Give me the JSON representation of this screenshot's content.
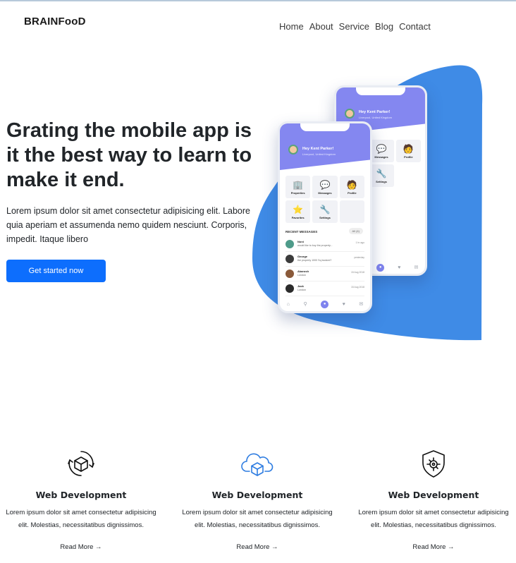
{
  "brand": "BRAINFooD",
  "nav": [
    "Home",
    "About",
    "Service",
    "Blog",
    "Contact"
  ],
  "hero": {
    "title": "Grating the mobile app is it the best way to learn to make it end.",
    "text": "Lorem ipsum dolor sit amet consectetur adipisicing elit. Labore quia aperiam et assumenda nemo quidem nesciunt. Corporis, impedit. Itaque libero",
    "cta": "Get started now"
  },
  "phone": {
    "greeting": "Hey Kent Parker!",
    "location": "Liverpool, United Kingdom",
    "tiles": [
      {
        "label": "Properties",
        "icon": "building-icon"
      },
      {
        "label": "Messages",
        "icon": "chat-icon"
      },
      {
        "label": "Profile",
        "icon": "person-icon"
      },
      {
        "label": "Favorites",
        "icon": "star-icon"
      },
      {
        "label": "Settings",
        "icon": "tools-icon"
      }
    ],
    "messages_title": "RECENT MESSAGES",
    "messages_badge": "All (4)",
    "messages": [
      {
        "name": "Noni",
        "text": "would like to buy the property...",
        "time": "1 hr ago"
      },
      {
        "name": "George",
        "text": "the property 1000 Sq booked?",
        "time": "yesterday"
      },
      {
        "name": "Akarosh",
        "text": "London",
        "time": "15 Aug 2018"
      },
      {
        "name": "Jack",
        "text": "London",
        "time": "15 Aug 2018"
      }
    ]
  },
  "features": [
    {
      "title": "Web Development",
      "text": "Lorem ipsum dolor sit amet consectetur adipisicing elit. Molestias, necessitatibus dignissimos.",
      "link": "Read More →",
      "icon": "cube-cycle-icon"
    },
    {
      "title": "Web Development",
      "text": "Lorem ipsum dolor sit amet consectetur adipisicing elit. Molestias, necessitatibus dignissimos.",
      "link": "Read More →",
      "icon": "cloud-cube-icon"
    },
    {
      "title": "Web Development",
      "text": "Lorem ipsum dolor sit amet consectetur adipisicing elit. Molestias, necessitatibus dignissimos.",
      "link": "Read More →",
      "icon": "shield-gear-icon"
    }
  ],
  "colors": {
    "accent": "#0d6efd",
    "blob": "#3f8be6",
    "phone_header": "#8487f0"
  }
}
